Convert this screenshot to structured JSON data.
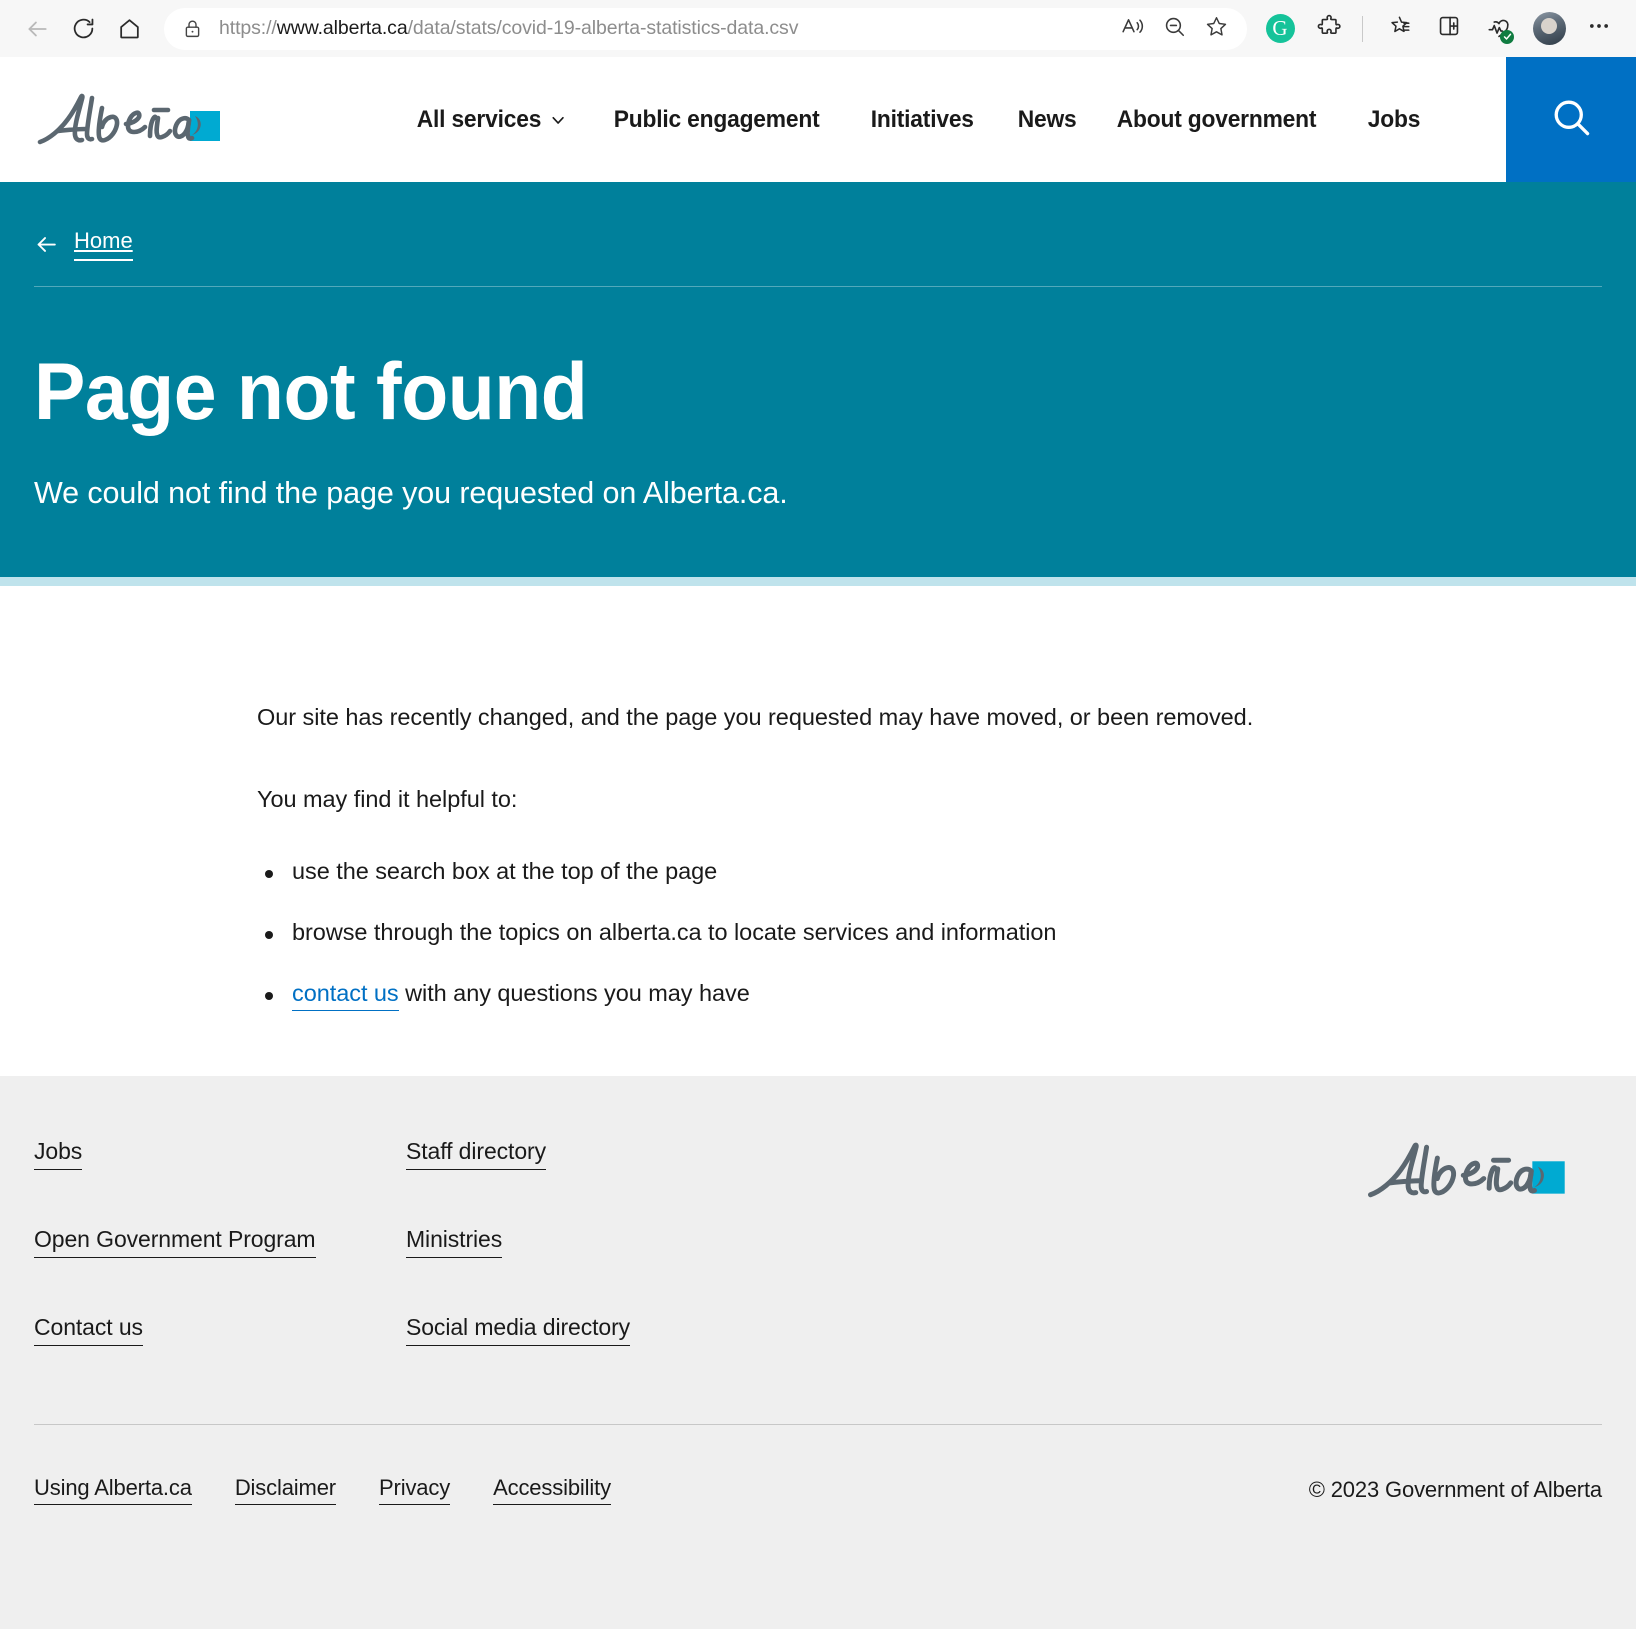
{
  "browser": {
    "back_icon": "arrow-left-icon",
    "refresh_icon": "refresh-icon",
    "home_icon": "home-icon",
    "lock_icon": "lock-icon",
    "url_protocol": "https://",
    "url_domain": "www.alberta.ca",
    "url_path": "/data/stats/covid-19-alberta-statistics-data.csv",
    "url_full": "https://www.alberta.ca/data/stats/covid-19-alberta-statistics-data.csv",
    "read_aloud_icon": "read-aloud-icon",
    "zoom_out_icon": "zoom-out-icon",
    "favorite_icon": "star-icon",
    "grammarly_icon": "grammarly-icon",
    "grammarly_letter": "G",
    "extensions_icon": "extensions-puzzle-icon",
    "collections_icon": "favorites-list-icon",
    "split_screen_icon": "split-screen-icon",
    "browser_essentials_icon": "browser-essentials-icon",
    "profile_icon": "profile-avatar",
    "settings_icon": "more-options-icon"
  },
  "header": {
    "logo_alt": "Alberta",
    "nav": [
      {
        "label": "All services",
        "has_caret": true
      },
      {
        "label": "Public engagement",
        "has_caret": false
      },
      {
        "label": "Initiatives",
        "has_caret": false
      },
      {
        "label": "News",
        "has_caret": false
      },
      {
        "label": "About government",
        "has_caret": false
      },
      {
        "label": "Jobs",
        "has_caret": false
      }
    ],
    "search_icon": "search-icon",
    "search_button_color": "#0070c4"
  },
  "hero": {
    "breadcrumb_label": "Home",
    "breadcrumb_icon": "arrow-left-icon",
    "title": "Page not found",
    "subtitle": "We could not find the page you requested on Alberta.ca.",
    "background_color": "#00809b",
    "strip_color": "#bfe3ec"
  },
  "main": {
    "paragraph_1": "Our site has recently changed, and the page you requested may have moved, or been removed.",
    "paragraph_2": "You may find it helpful to:",
    "bullets": [
      {
        "text": "use the search box at the top of the page",
        "link": null,
        "after": null
      },
      {
        "text": "browse through the topics on alberta.ca to locate services and information",
        "link": null,
        "after": null
      },
      {
        "text": null,
        "link": "contact us",
        "after": " with any questions you may have"
      }
    ],
    "link_color": "#0070c4"
  },
  "footer": {
    "columns": [
      {
        "links": [
          "Jobs",
          "Open Government Program",
          "Contact us"
        ]
      },
      {
        "links": [
          "Staff directory",
          "Ministries",
          "Social media directory"
        ]
      }
    ],
    "logo_alt": "Alberta",
    "legal_links": [
      "Using Alberta.ca",
      "Disclaimer",
      "Privacy",
      "Accessibility"
    ],
    "copyright": "© 2023 Government of Alberta",
    "background_color": "#efefef"
  }
}
